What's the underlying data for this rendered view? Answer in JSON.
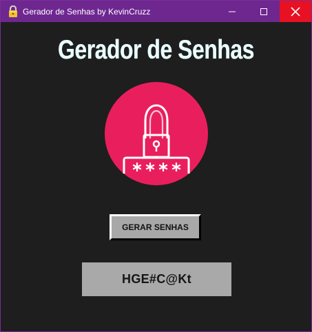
{
  "window": {
    "title": "Gerador de Senhas by KevinCruzz",
    "controls": {
      "minimize": "—",
      "maximize": "☐",
      "close": "✕"
    }
  },
  "content": {
    "heading": "Gerador de Senhas",
    "illustration": {
      "icon": "lock-password-icon",
      "masked_password": "****",
      "colors": {
        "circle": "#e91f5d",
        "line": "#ffffff"
      }
    },
    "generate_button_label": "GERAR SENHAS",
    "generated_password": "HGE#C@Kt"
  },
  "colors": {
    "titlebar": "#6f2790",
    "background": "#1e1e1e",
    "heading": "#e9ffff",
    "close_hover": "#e81123",
    "button": "#a8a8a8"
  }
}
